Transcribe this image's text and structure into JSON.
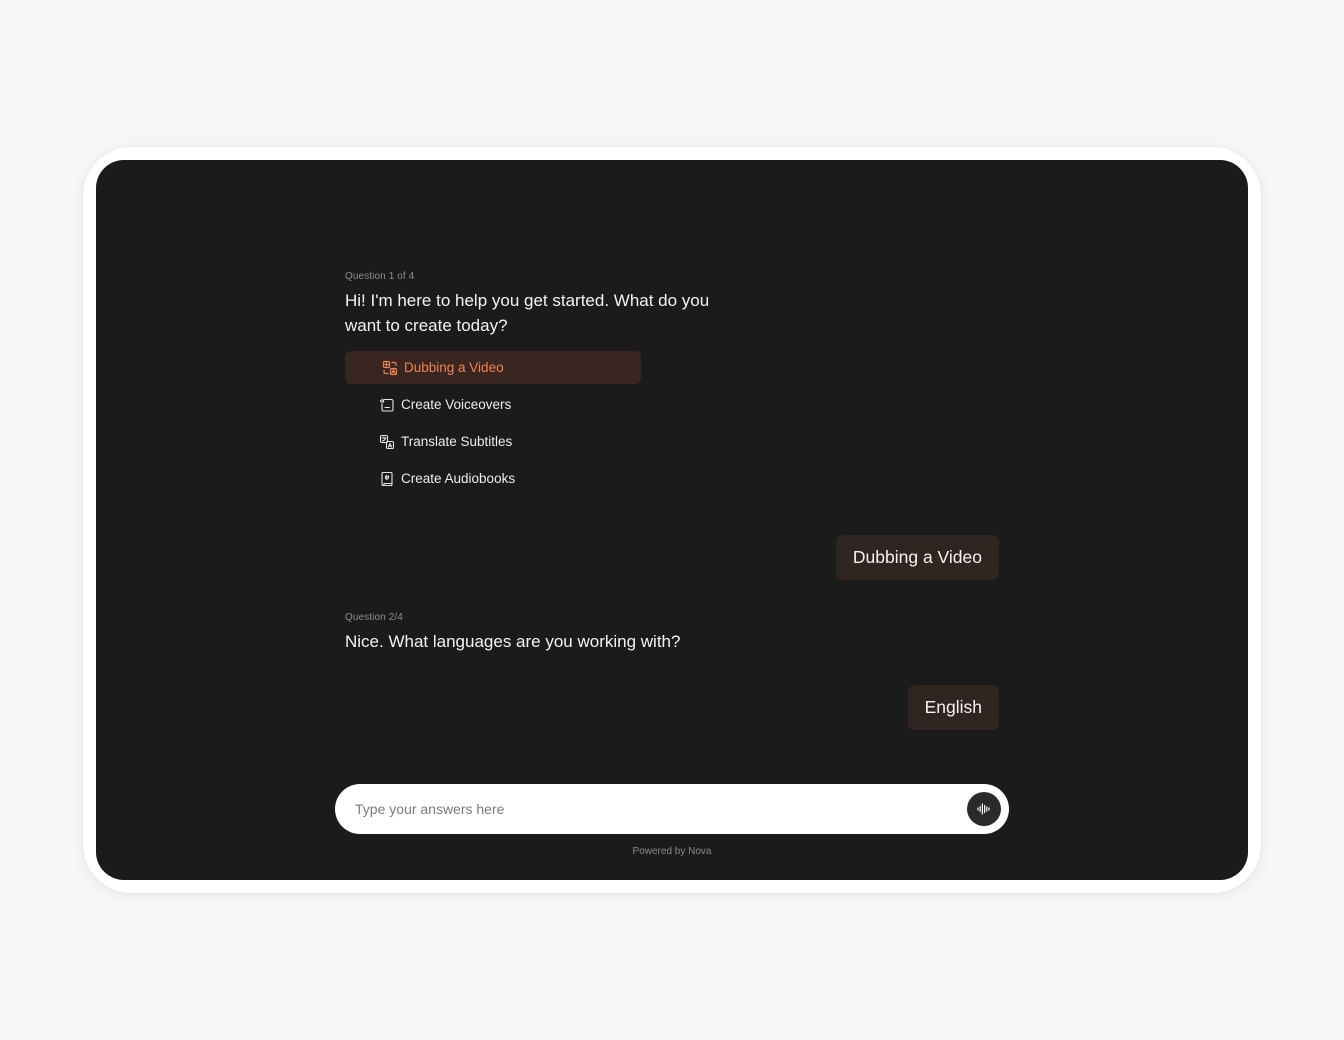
{
  "conversation": {
    "q1": {
      "label": "Question 1 of 4",
      "text": "Hi! I'm here to help you get started. What do you want to create today?",
      "options": [
        {
          "label": "Dubbing a Video",
          "icon": "dubbing-icon",
          "selected": true
        },
        {
          "label": "Create Voiceovers",
          "icon": "voiceover-icon",
          "selected": false
        },
        {
          "label": "Translate Subtitles",
          "icon": "translate-icon",
          "selected": false
        },
        {
          "label": "Create Audiobooks",
          "icon": "audiobook-icon",
          "selected": false
        }
      ],
      "answer": "Dubbing a Video"
    },
    "q2": {
      "label": "Question 2/4",
      "text": "Nice. What languages are you working with?",
      "answer": "English"
    }
  },
  "input": {
    "placeholder": "Type your answers here",
    "value": ""
  },
  "footer": {
    "text": "Powered by Nova"
  },
  "colors": {
    "screen_bg": "#1b1b1b",
    "accent": "#ee8451",
    "selected_option_bg": "#3a2621",
    "answer_bubble_bg": "#2f2521"
  }
}
